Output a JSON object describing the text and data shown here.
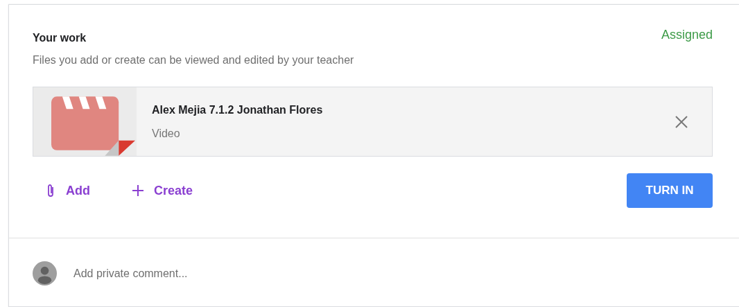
{
  "section": {
    "title": "Your work",
    "status": "Assigned",
    "subtitle": "Files you add or create can be viewed and edited by your teacher"
  },
  "attachments": [
    {
      "kind": "video",
      "title": "Alex Mejia 7.1.2 Jonathan Flores",
      "type": "Video"
    }
  ],
  "actions": [
    {
      "kind": "add",
      "label": "Add"
    },
    {
      "kind": "create",
      "label": "Create"
    }
  ],
  "turn_in": {
    "label": "TURN IN"
  },
  "comment": {
    "placeholder": "Add private comment..."
  }
}
